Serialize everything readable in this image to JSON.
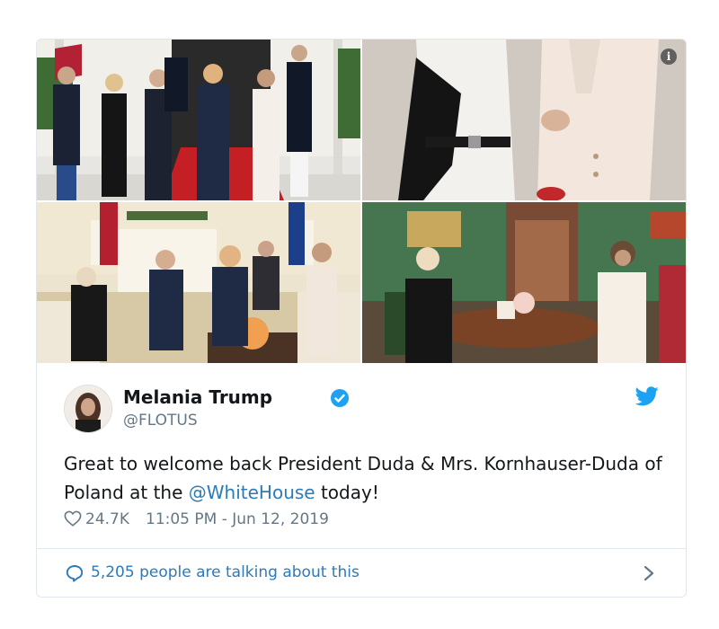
{
  "tweet": {
    "author_name": "Melania Trump",
    "author_handle": "@FLOTUS",
    "text_part1": "Great to welcome back President Duda & Mrs. Kornhauser-Duda of Poland at the ",
    "mention": "@WhiteHouse",
    "text_part2": " today!",
    "likes": "24.7K",
    "timestamp": "11:05 PM - Jun 12, 2019",
    "talking": "5,205 people are talking about this"
  },
  "icons": {
    "info": "info-icon",
    "verified": "verified-badge-icon",
    "twitter": "twitter-bird-icon",
    "like": "heart-icon",
    "reply": "speech-bubble-icon",
    "expand": "chevron-right-icon"
  },
  "colors": {
    "link": "#2b7bb9",
    "muted": "#657786",
    "twitter_blue": "#1da1f2",
    "border": "#e1e8ed"
  }
}
